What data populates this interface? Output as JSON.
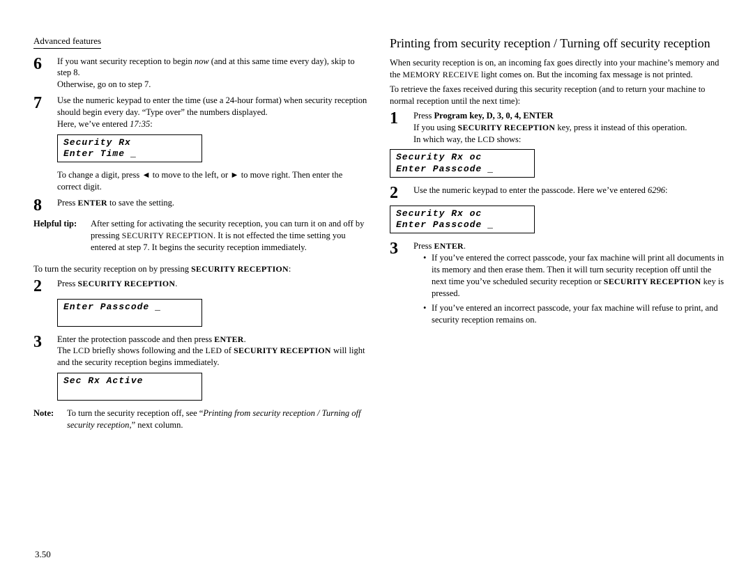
{
  "section_label": "Advanced features",
  "left": {
    "step6": {
      "num": "6",
      "p1a": "If you want security reception to begin ",
      "p1i": "now",
      "p1b": " (and at this same time every day), skip to step 8.",
      "p2": "Otherwise, go on to step 7."
    },
    "step7": {
      "num": "7",
      "p1": "Use the numeric keypad to enter the time (use a 24-hour format) when security reception should begin every day. “Type over” the numbers displayed.",
      "p2a": "Here, we’ve entered ",
      "p2i": "17:35",
      "p2b": ":"
    },
    "lcd1_line1": "Security Rx",
    "lcd1_line2": "Enter Time    _",
    "after_lcd1": "To change a digit, press ◄ to move to the left, or ► to move right. Then enter the correct digit.",
    "step8": {
      "num": "8",
      "p1a": "Press ",
      "enter": "ENTER",
      "p1b": " to save the setting."
    },
    "helpful_label": "Helpful tip:",
    "helpful_body": "After setting for activating the security reception, you can turn it on and off by pressing SECURITY RECEPTION. It is not effected the time setting you entered at step 7. It begins the security reception immediately.",
    "turn_on_line_a": "To turn the security reception on by pressing ",
    "turn_on_sc": "SECURITY RECEPTION",
    "turn_on_line_b": ":",
    "step2": {
      "num": "2",
      "p_a": "Press ",
      "sc": "SECURITY RECEPTION",
      "p_b": "."
    },
    "lcd2_line1": "Enter Passcode _",
    "lcd2_line2": "",
    "step3": {
      "num": "3",
      "p1a": "Enter the protection passcode and then press ",
      "enter": "ENTER",
      "p1b": ".",
      "p2a": "The ",
      "lcd": "LCD",
      "p2b": " briefly shows following and the ",
      "led": "LED",
      "p2c": " of ",
      "sc": "SECURITY RECEPTION",
      "p2d": " will light and the security reception begins immediately."
    },
    "lcd3_line1": "Sec  Rx Active",
    "lcd3_line2": "",
    "note_label": "Note:",
    "note_a": "To turn the security reception off, see “",
    "note_i": "Printing from security reception / Turning off security reception",
    "note_b": ",” next column."
  },
  "right": {
    "heading": "Printing from security reception / Turning off security reception",
    "intro": "When security reception is on, an incoming fax goes directly into your machine’s memory and the MEMORY RECEIVE light comes on. But the incoming fax message is not printed.",
    "intro2": "To retrieve the faxes received during this security reception (and to return your machine to normal reception until the next time):",
    "step1": {
      "num": "1",
      "p1a": "Press ",
      "p1b": "Program key, D, 3, 0, 4, ENTER",
      "p2a": "If you using ",
      "sc": "SECURITY RECEPTION",
      "p2b": " key, press it instead of this operation.",
      "p3a": "In which way, the ",
      "lcd": "LCD",
      "p3b": " shows:"
    },
    "lcd1_line1": "Security Rx   oc",
    "lcd1_line2": "Enter Passcode _",
    "step2": {
      "num": "2",
      "p_a": "Use the numeric keypad to enter the passcode. Here we’ve entered ",
      "p_i": "6296",
      "p_b": ":"
    },
    "lcd2_line1": "Security Rx   oc",
    "lcd2_line2": "Enter Passcode _",
    "step3": {
      "num": "3",
      "p1a": "Press ",
      "enter": "ENTER",
      "p1b": "."
    },
    "bullet1_a": "If you’ve entered the correct passcode, your fax machine will print all documents in its memory and then erase them. Then it will turn security reception off until the next time you’ve scheduled security reception or ",
    "bullet1_sc": "SECURITY RECEPTION",
    "bullet1_b": " key is pressed.",
    "bullet2": "If you’ve entered an incorrect passcode, your fax machine will refuse to print, and security reception remains on."
  },
  "page_number": "3.50"
}
